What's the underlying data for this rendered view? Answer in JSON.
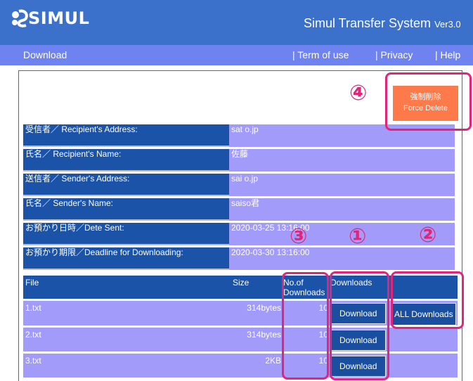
{
  "header": {
    "logo_text": "SIMUL",
    "system_title": "Simul Transfer System",
    "version": "Ver3.0"
  },
  "nav": {
    "page_name": "Download",
    "links": [
      "| Term of use",
      "| Privacy",
      "| Help"
    ]
  },
  "force_delete": {
    "label_ja": "強制削除",
    "label_en": "Force Delete"
  },
  "info_rows": [
    {
      "label": "受信者／ Recipient's Address:",
      "value": "sat                 o.jp"
    },
    {
      "label": "氏名／ Recipient's Name:",
      "value": "佐藤"
    },
    {
      "label": "送信者／ Sender's Address:",
      "value": "sai                 o.jp"
    },
    {
      "label": "氏名／ Sender's Name:",
      "value": "saiso君"
    },
    {
      "label": "お預かり日時／Dete Sent:",
      "value": "2020-03-25 13:16:00"
    },
    {
      "label": "お預かり期限／Deadline for Downloading:",
      "value": "2020-03-30 13:16:00"
    }
  ],
  "file_table": {
    "headers": [
      "File",
      "Size",
      "No.of Downloads",
      "Downloads",
      ""
    ],
    "rows": [
      {
        "file": "1.txt",
        "size": "314bytes",
        "count": "10",
        "button": "Download"
      },
      {
        "file": "2.txt",
        "size": "314bytes",
        "count": "10",
        "button": "Download"
      },
      {
        "file": "3.txt",
        "size": "2KB",
        "count": "10",
        "button": "Download"
      }
    ],
    "all_downloads_label": "ALL Downloads"
  },
  "annotations": {
    "one": "①",
    "two": "②",
    "three": "③",
    "four": "④",
    "color": "#e0257a"
  },
  "colors": {
    "header_bg": "#3b70cb",
    "nav_bg": "#6f83f0",
    "label_bg": "#1a53a8",
    "value_bg": "#a39bf9",
    "force_delete_bg": "#ff7a4a"
  }
}
